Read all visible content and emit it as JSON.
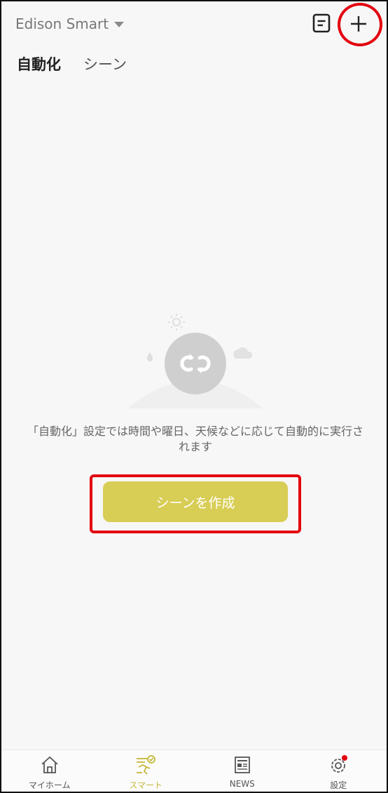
{
  "header": {
    "home_name": "Edison Smart"
  },
  "tabs": [
    {
      "label": "自動化",
      "active": true
    },
    {
      "label": "シーン",
      "active": false
    }
  ],
  "empty_state": {
    "description": "「自動化」設定では時間や曜日、天候などに応じて自動的に実行されます",
    "button_label": "シーンを作成"
  },
  "bottom_nav": [
    {
      "label": "マイホーム",
      "icon": "home-icon",
      "active": false
    },
    {
      "label": "スマート",
      "icon": "smart-icon",
      "active": true
    },
    {
      "label": "NEWS",
      "icon": "news-icon",
      "active": false
    },
    {
      "label": "設定",
      "icon": "settings-icon",
      "active": false
    }
  ],
  "colors": {
    "accent": "#d8cd55",
    "active_nav": "#c6b838",
    "annotation": "#e3000f",
    "background": "#f7f7f7"
  }
}
